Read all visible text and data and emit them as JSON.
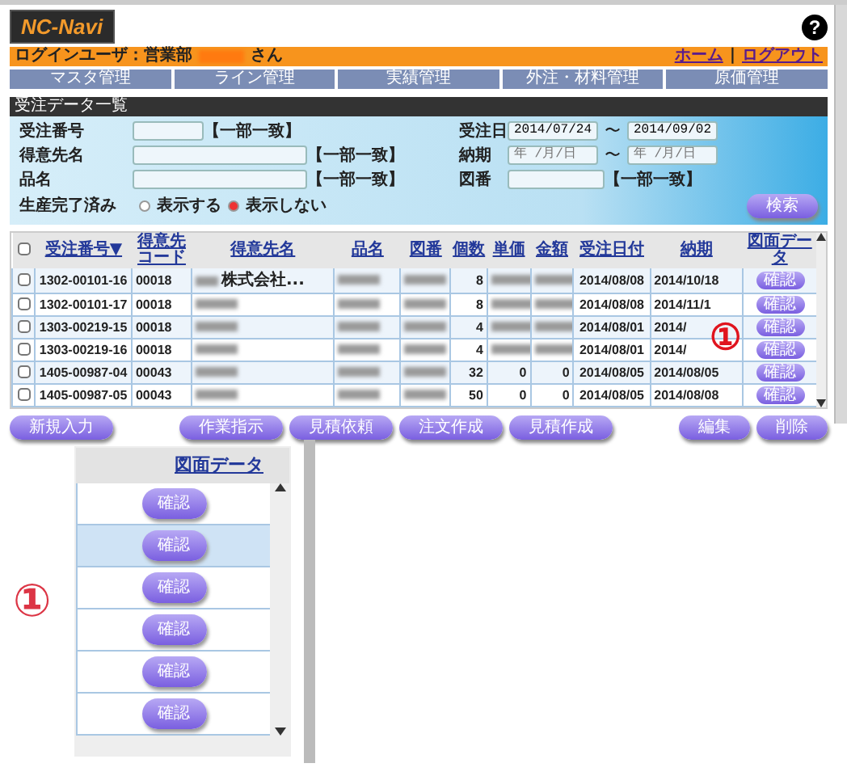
{
  "header": {
    "logo": "NC-Navi",
    "help": "?"
  },
  "user_bar": {
    "prefix": "ログインユーザ：営業部",
    "suffix": "さん",
    "links": [
      "ホーム",
      "ログアウト"
    ],
    "separator": "|"
  },
  "nav": [
    "マスタ管理",
    "ライン管理",
    "実績管理",
    "外注・材料管理",
    "原価管理"
  ],
  "panel_title": "受注データ一覧",
  "search": {
    "rows": [
      {
        "left": {
          "label": "受注番号",
          "wide": false,
          "hint": "【一部一致】"
        },
        "right": {
          "label": "受注日",
          "kind": "range",
          "from": {
            "value": "2014/07/24"
          },
          "to": {
            "value": "2014/09/02"
          },
          "sep": "〜"
        }
      },
      {
        "left": {
          "label": "得意先名",
          "wide": true,
          "hint": "【一部一致】"
        },
        "right": {
          "label": "納期",
          "kind": "range",
          "from": {
            "placeholder": "年 /月/日"
          },
          "to": {
            "placeholder": "年 /月/日"
          },
          "sep": "〜"
        }
      },
      {
        "left": {
          "label": "品名",
          "wide": true,
          "hint": "【一部一致】"
        },
        "right": {
          "label": "図番",
          "kind": "text",
          "hint": "【一部一致】"
        }
      }
    ],
    "completed": {
      "label": "生産完了済み",
      "options": [
        {
          "label": "表示する",
          "selected": false
        },
        {
          "label": "表示しない",
          "selected": true
        }
      ]
    },
    "button": "検索"
  },
  "table": {
    "select_all_checked": false,
    "columns": [
      "受注番号▼",
      "得意先コード",
      "得意先名",
      "品名",
      "図番",
      "個数",
      "単価",
      "金額",
      "受注日付",
      "納期",
      "図面データ"
    ],
    "rows": [
      {
        "checked": false,
        "cells": [
          {
            "text": "1302-00101-16"
          },
          {
            "text": "00018"
          },
          {
            "text": "株式会社...",
            "redacted": true
          },
          {
            "redacted": true
          },
          {
            "redacted": true
          },
          {
            "text": "8"
          },
          {
            "redacted": true
          },
          {
            "redacted": true
          },
          {
            "text": "2014/08/08"
          },
          {
            "text": "2014/10/18"
          }
        ],
        "button": "確認"
      },
      {
        "checked": false,
        "cells": [
          {
            "text": "1302-00101-17"
          },
          {
            "text": "00018"
          },
          {
            "redacted": true
          },
          {
            "redacted": true
          },
          {
            "redacted": true
          },
          {
            "text": "8"
          },
          {
            "redacted": true
          },
          {
            "redacted": true
          },
          {
            "text": "2014/08/08"
          },
          {
            "text": "2014/11/1"
          }
        ],
        "button": "確認"
      },
      {
        "checked": false,
        "cells": [
          {
            "text": "1303-00219-15"
          },
          {
            "text": "00018"
          },
          {
            "redacted": true
          },
          {
            "redacted": true
          },
          {
            "redacted": true
          },
          {
            "text": "4"
          },
          {
            "redacted": true
          },
          {
            "redacted": true
          },
          {
            "text": "2014/08/01"
          },
          {
            "text": "2014/"
          }
        ],
        "button": "確認"
      },
      {
        "checked": false,
        "cells": [
          {
            "text": "1303-00219-16"
          },
          {
            "text": "00018"
          },
          {
            "redacted": true
          },
          {
            "redacted": true
          },
          {
            "redacted": true
          },
          {
            "text": "4"
          },
          {
            "redacted": true
          },
          {
            "redacted": true
          },
          {
            "text": "2014/08/01"
          },
          {
            "text": "2014/"
          }
        ],
        "button": "確認"
      },
      {
        "checked": false,
        "cells": [
          {
            "text": "1405-00987-04"
          },
          {
            "text": "00043"
          },
          {
            "redacted": true
          },
          {
            "redacted": true
          },
          {
            "redacted": true
          },
          {
            "text": "32"
          },
          {
            "text": "0"
          },
          {
            "text": "0"
          },
          {
            "text": "2014/08/05"
          },
          {
            "text": "2014/08/05"
          }
        ],
        "button": "確認"
      },
      {
        "checked": false,
        "cells": [
          {
            "text": "1405-00987-05"
          },
          {
            "text": "00043"
          },
          {
            "redacted": true
          },
          {
            "redacted": true
          },
          {
            "redacted": true
          },
          {
            "text": "50"
          },
          {
            "text": "0"
          },
          {
            "text": "0"
          },
          {
            "text": "2014/08/05"
          },
          {
            "text": "2014/08/08"
          }
        ],
        "button": "確認"
      }
    ]
  },
  "callout": "①",
  "actions": {
    "left": [
      "新規入力"
    ],
    "middle": [
      "作業指示",
      "見積依頼",
      "注文作成",
      "見積作成"
    ],
    "right": [
      "編集",
      "削除"
    ]
  },
  "inset": {
    "callout": "①",
    "header": "図面データ",
    "rows": [
      {
        "button": "確認",
        "selected": false
      },
      {
        "button": "確認",
        "selected": true
      },
      {
        "button": "確認",
        "selected": false
      },
      {
        "button": "確認",
        "selected": false
      },
      {
        "button": "確認",
        "selected": false
      },
      {
        "button": "確認",
        "selected": false
      }
    ]
  }
}
